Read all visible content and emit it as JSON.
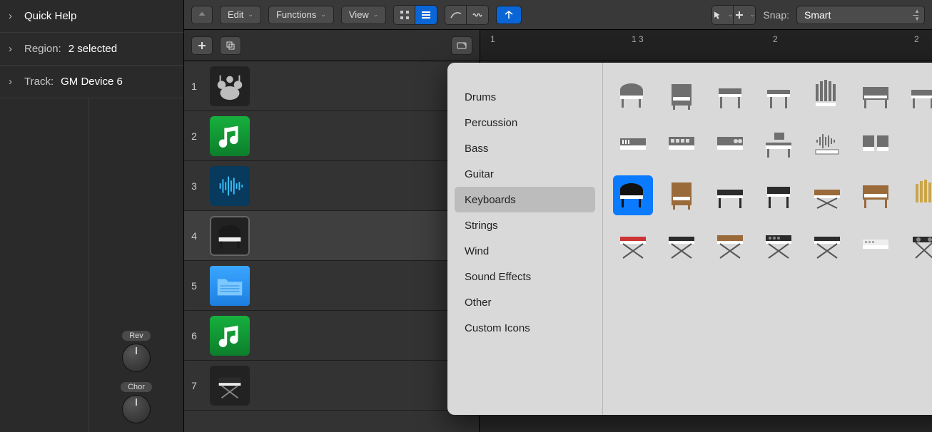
{
  "inspector": {
    "quick_help": "Quick Help",
    "region_label": "Region:",
    "region_value": "2 selected",
    "track_label": "Track:",
    "track_value": "GM Device 6",
    "knob1": "Rev",
    "knob2": "Chor"
  },
  "toolbar": {
    "edit": "Edit",
    "functions": "Functions",
    "view": "View",
    "snap_label": "Snap:",
    "snap_value": "Smart"
  },
  "ruler": {
    "m1": "1",
    "m1b": "1 3",
    "m2": "2",
    "m2b": "2"
  },
  "tracks": [
    {
      "num": "1",
      "name": ""
    },
    {
      "num": "2",
      "name": ""
    },
    {
      "num": "3",
      "name": ""
    },
    {
      "num": "4",
      "name": ""
    },
    {
      "num": "5",
      "name": ""
    },
    {
      "num": "6",
      "name": ""
    },
    {
      "num": "7",
      "name": ""
    }
  ],
  "popover": {
    "categories": [
      "Drums",
      "Percussion",
      "Bass",
      "Guitar",
      "Keyboards",
      "Strings",
      "Wind",
      "Sound Effects",
      "Other",
      "Custom Icons"
    ],
    "selected_category": "Keyboards",
    "row1": [
      "grand-piano-flat-icon",
      "upright-piano-flat-icon",
      "electric-piano-flat-icon",
      "clavinet-flat-icon",
      "pipe-organ-flat-icon",
      "combo-organ-flat-icon",
      "synth-flat-icon",
      "keytar-flat-icon",
      "module-rack-flat-icon",
      "mixer-flat-icon"
    ],
    "row2": [
      "workstation-flat-icon",
      "drum-machine-flat-icon",
      "sampler-flat-icon",
      "desk-keys-flat-icon",
      "waveform-keys-flat-icon",
      "controller-flat-icon"
    ],
    "row3": [
      "grand-piano-icon",
      "upright-piano-icon",
      "stage-piano-icon",
      "console-piano-icon",
      "rhodes-icon",
      "tonewheel-organ-icon",
      "pipe-organ-icon",
      "accordion-icon",
      "white-keys-icon",
      "keytar-stand-icon"
    ],
    "row4": [
      "red-synth-stand-icon",
      "black-synth-stand-icon",
      "moog-stand-icon",
      "poly-synth-stand-icon",
      "controller-stand-icon",
      "mini-keys-icon",
      "dj-stand-icon"
    ],
    "selected_icon": "grand-piano-icon"
  }
}
